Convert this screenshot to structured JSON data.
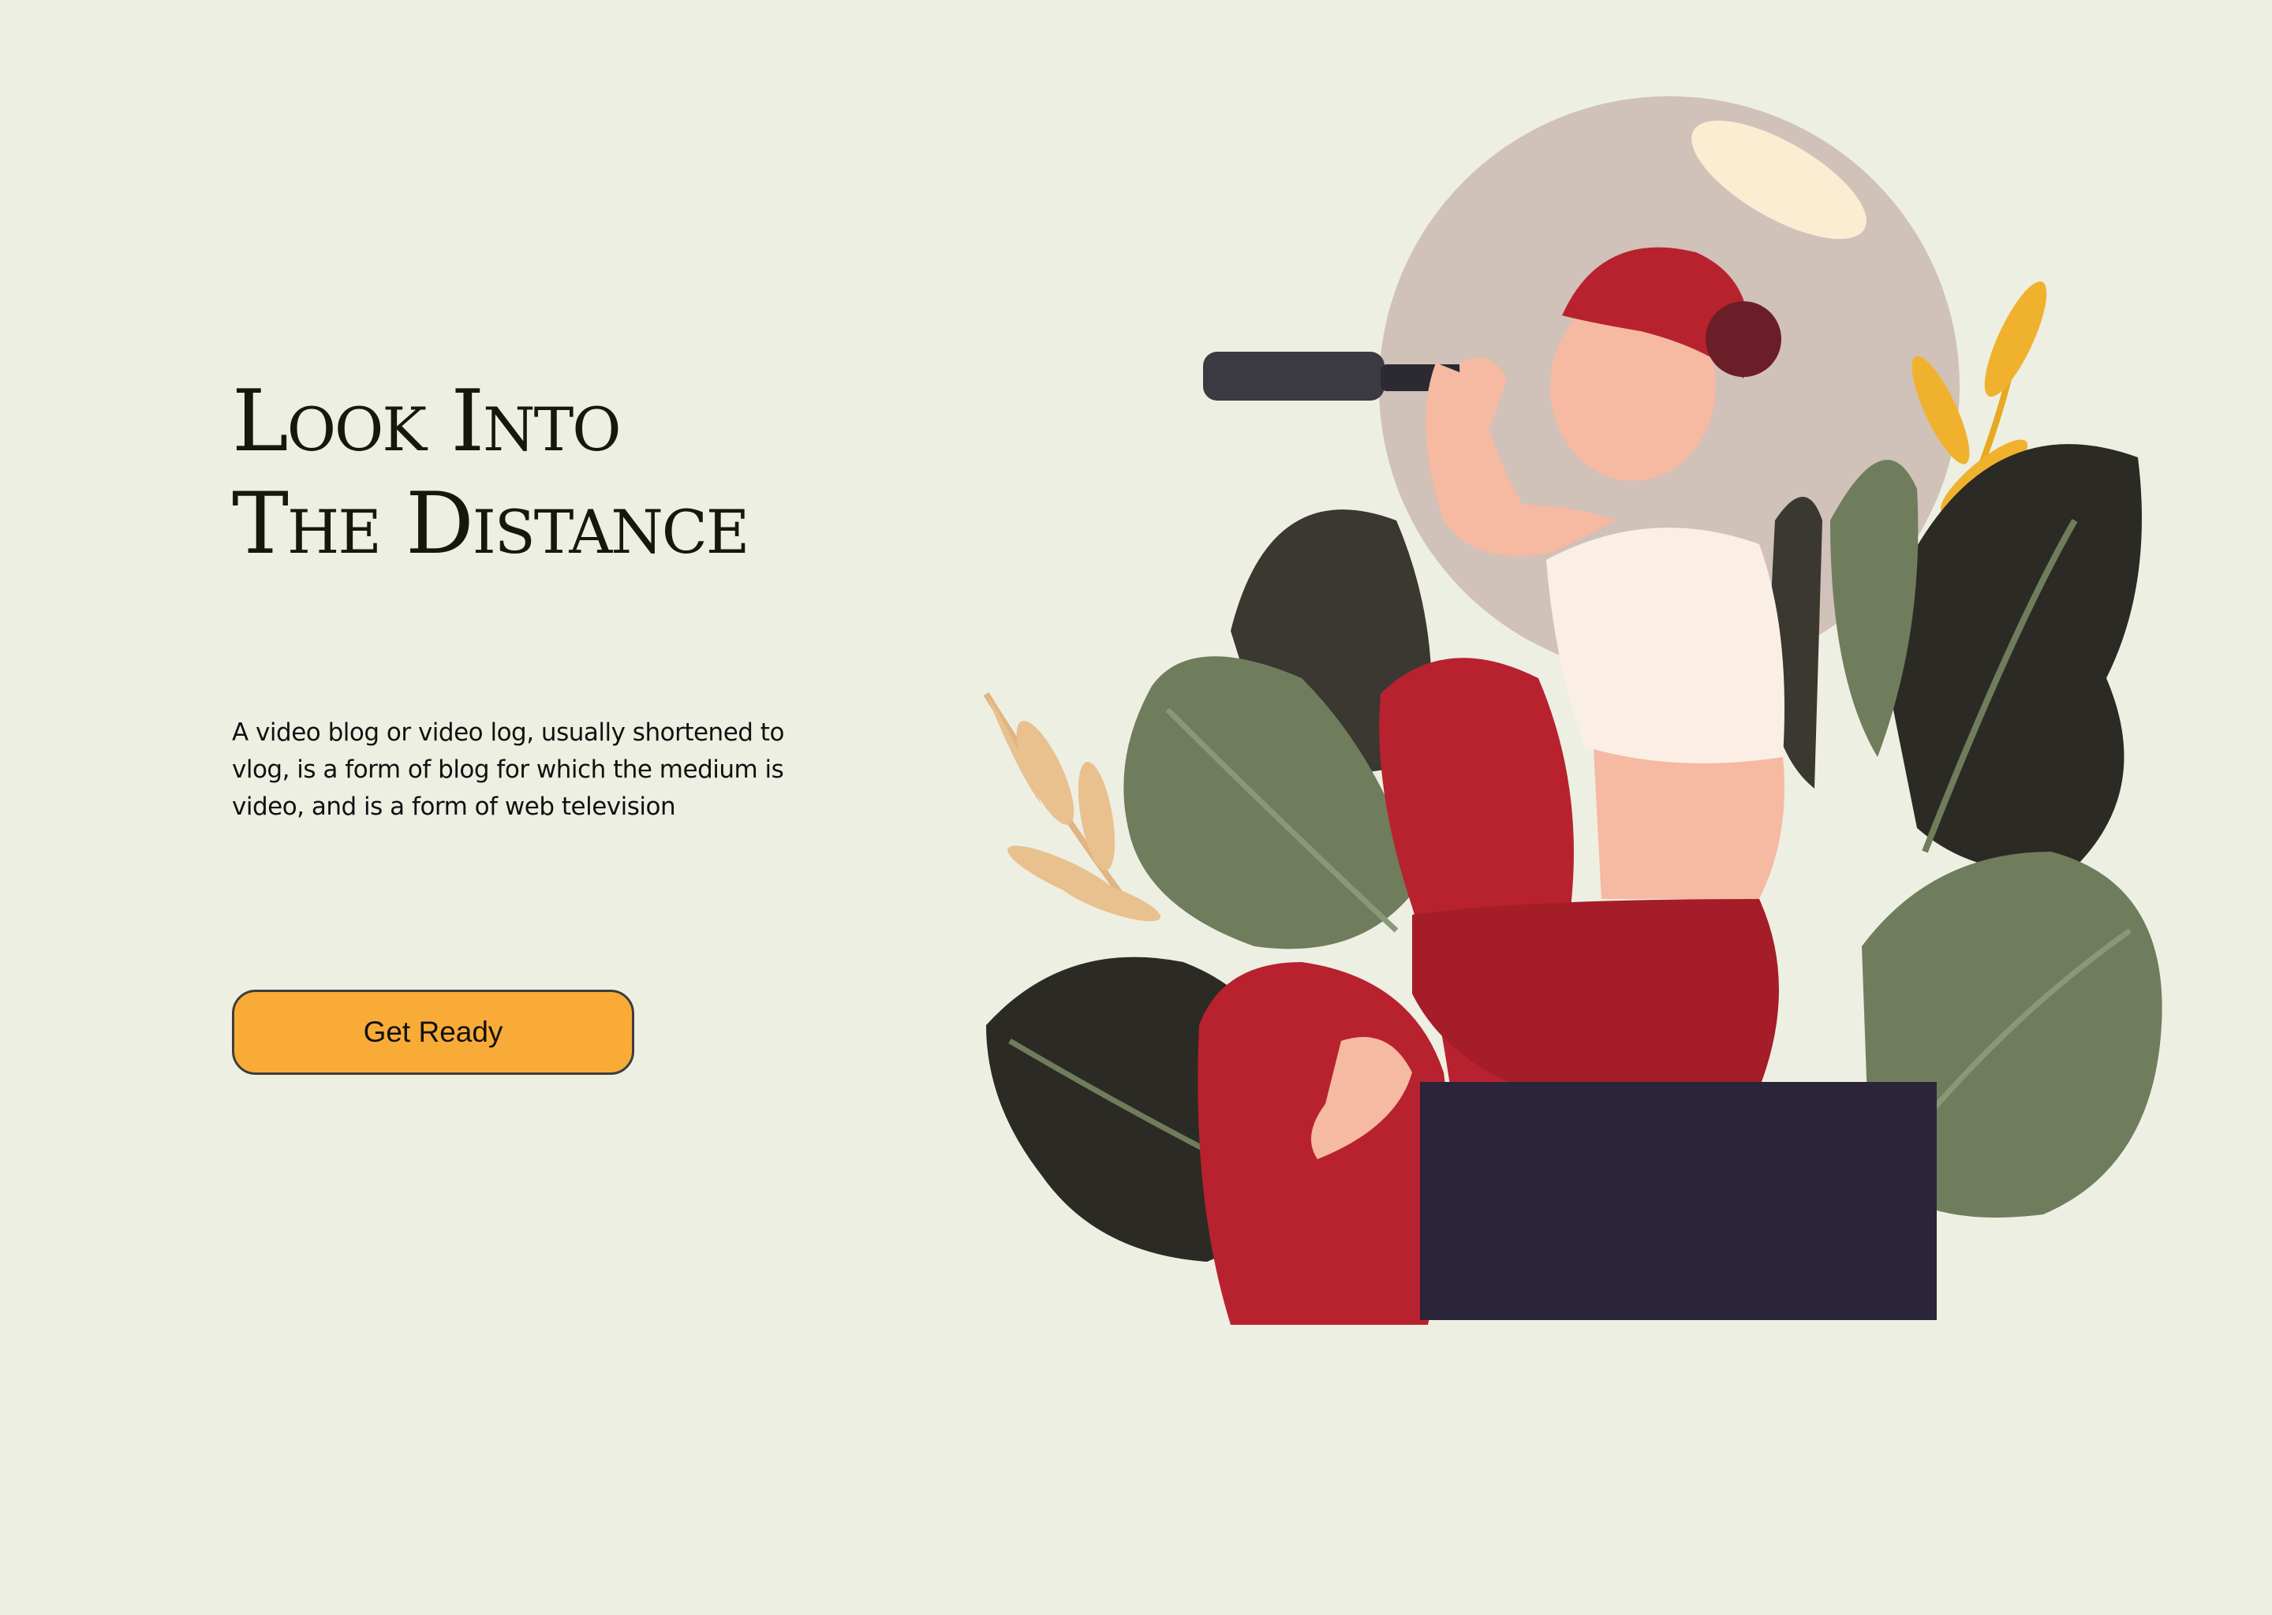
{
  "hero": {
    "title_line_1": "Look Into",
    "title_line_2": "The Distance",
    "description": "A video blog or video log, usually shortened to vlog, is a form of blog for which the medium is video, and is a form of web television",
    "button_label": "Get Ready"
  },
  "colors": {
    "background": "#eeefe3",
    "button": "#f9ab38",
    "text": "#17170f",
    "accent_red": "#b8222e",
    "leaf_green": "#6f7d5d",
    "leaf_dark": "#2c2a24",
    "box": "#2b2539",
    "moon": "#d0c1b9"
  },
  "illustration": {
    "subject": "woman-with-telescope",
    "icons": [
      "telescope-icon",
      "leaf-icon",
      "wheat-branch-icon"
    ]
  }
}
